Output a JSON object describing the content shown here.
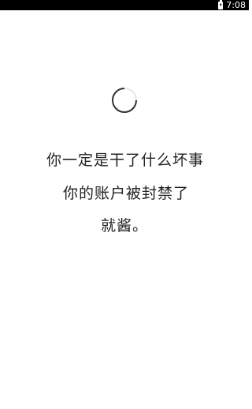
{
  "status_bar": {
    "time": "7:08",
    "battery_icon": "battery-charging-icon"
  },
  "loading": {
    "spinner_icon": "loading-spinner-icon"
  },
  "message": {
    "line1": "你一定是干了什么坏事",
    "line2": "你的账户被封禁了",
    "line3": "就酱。"
  }
}
